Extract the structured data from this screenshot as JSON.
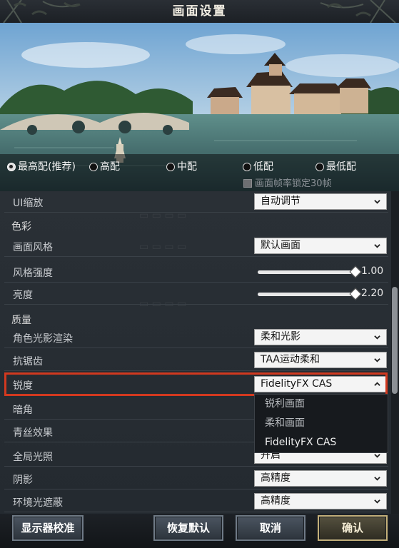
{
  "window": {
    "title": "画面设置"
  },
  "presets": {
    "items": [
      {
        "label": "最高配(推荐)",
        "selected": true
      },
      {
        "label": "高配",
        "selected": false
      },
      {
        "label": "中配",
        "selected": false
      },
      {
        "label": "低配",
        "selected": false
      },
      {
        "label": "最低配",
        "selected": false
      }
    ],
    "lock_label": "画面帧率锁定30帧",
    "lock_checked": false
  },
  "settings": {
    "ui_scale": {
      "label": "UI缩放",
      "value": "自动调节"
    },
    "section_color": "色彩",
    "style": {
      "label": "画面风格",
      "value": "默认画面"
    },
    "style_strength": {
      "label": "风格强度",
      "value": "1.00",
      "fraction": 1.0
    },
    "brightness": {
      "label": "亮度",
      "value": "2.20",
      "fraction": 1.0
    },
    "section_quality": "质量",
    "char_lighting": {
      "label": "角色光影渲染",
      "value": "柔和光影"
    },
    "antialias": {
      "label": "抗锯齿",
      "value": "TAA运动柔和"
    },
    "sharpness": {
      "label": "锐度",
      "value": "FidelityFX  CAS",
      "expanded": true,
      "options": [
        "锐利画面",
        "柔和画面",
        "FidelityFX  CAS"
      ]
    },
    "vignette": {
      "label": "暗角"
    },
    "ink_effect": {
      "label": "青丝效果"
    },
    "global_illum": {
      "label": "全局光照",
      "value": "开启"
    },
    "shadow": {
      "label": "阴影",
      "value": "高精度"
    },
    "ao": {
      "label": "环境光遮蔽",
      "value": "高精度"
    }
  },
  "buttons": {
    "calibrate": "显示器校准",
    "restore": "恢复默认",
    "cancel": "取消",
    "confirm": "确认"
  },
  "colors": {
    "highlight": "#d2391f",
    "dropdown_bg": "#f4f4f4"
  }
}
